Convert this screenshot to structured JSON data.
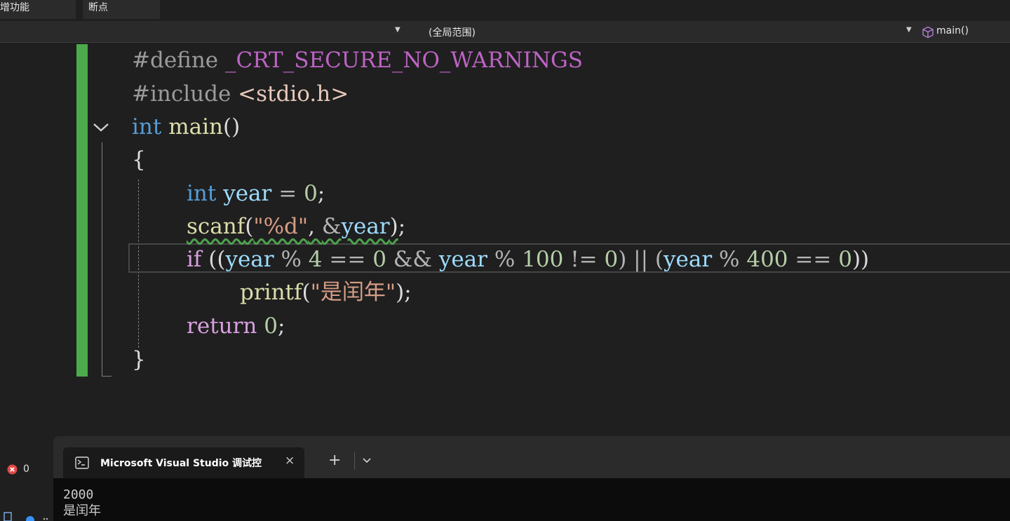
{
  "tabs": [
    "增功能",
    "断点"
  ],
  "nav": {
    "scope": "(全局范围)",
    "function": "main()"
  },
  "code": {
    "line1": {
      "directive": "#define",
      "macro": "_CRT_SECURE_NO_WARNINGS"
    },
    "line2": {
      "directive": "#include",
      "header": "<stdio.h>"
    },
    "line3": {
      "type": "int",
      "name": "main",
      "paren": "()"
    },
    "line4": "{",
    "line5": {
      "type": "int",
      "var": "year",
      "op": " = ",
      "num": "0",
      "end": ";"
    },
    "line6": {
      "fn": "scanf",
      "open": "(",
      "fmt": "\"%d\"",
      "sep": ", ",
      "amp": "&",
      "var": "year",
      "close": ")",
      "end": ";"
    },
    "line7": {
      "kw": "if",
      "t1": " ((",
      "v1": "year",
      "t2": " % ",
      "n1": "4",
      "t3": " == ",
      "n2": "0",
      "t4": " && ",
      "v2": "year",
      "t5": " % ",
      "n3": "100",
      "t6": " != ",
      "n4": "0",
      "t7": ") || (",
      "v3": "year",
      "t8": " % ",
      "n5": "400",
      "t9": " == ",
      "n6": "0",
      "t10": "))"
    },
    "line8": {
      "fn": "printf",
      "open": "(",
      "str": "\"是闰年\"",
      "close": ");"
    },
    "line9": {
      "kw": "return",
      "sp": " ",
      "num": "0",
      "end": ";"
    },
    "line10": "}"
  },
  "errors": {
    "count": "0"
  },
  "terminal": {
    "tab_title": "Microsoft Visual Studio 调试控",
    "close": "×",
    "new_tab": "+",
    "output": [
      "2000",
      "是闰年"
    ]
  },
  "colors": {
    "change_bar": "#4caa4c",
    "keyword": "#569cd6",
    "control": "#d8a0df",
    "function": "#dcdcaa",
    "variable": "#9cdcfe",
    "number": "#b5cea8",
    "string": "#d69d85",
    "macro": "#bd63c5",
    "error": "#e04848"
  },
  "icons": [
    "chevron-down-icon",
    "cube-icon",
    "collapse-chevron-icon",
    "error-icon",
    "console-icon",
    "close-icon",
    "plus-icon"
  ]
}
